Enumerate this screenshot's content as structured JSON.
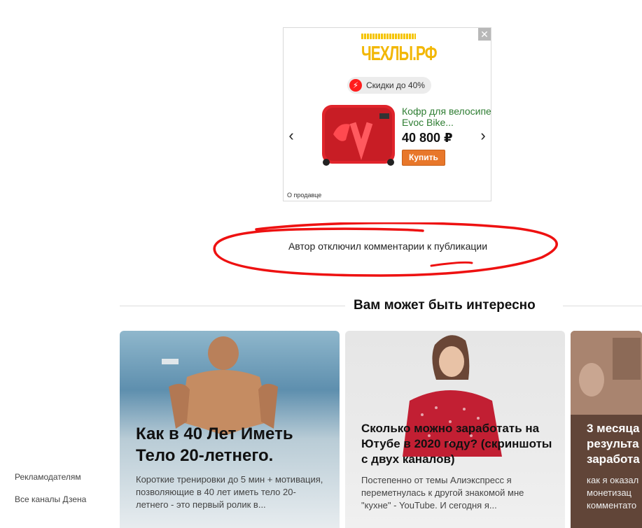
{
  "ad": {
    "close_glyph": "✕",
    "logo_text": "ЧЕХЛЫ.РФ",
    "discount_label": "Скидки до 40%",
    "product_title": "Кофр для велосипеда Evoc Bike...",
    "product_title_line1": "Кофр для велосипе,",
    "product_title_line2": "Evoc Bike...",
    "price": "40 800 ₽",
    "buy_label": "Купить",
    "seller_link": "О продавце",
    "prev_arrow": "‹",
    "next_arrow": "›",
    "icon_names": [
      "lightning-icon",
      "chevron-left-icon",
      "chevron-right-icon",
      "close-icon"
    ]
  },
  "comments": {
    "disabled_text": "Автор отключил комментарии к публикации",
    "annotation_color": "#e11"
  },
  "recommendations": {
    "title": "Вам может быть интересно",
    "cards": [
      {
        "title": "Как в 40 Лет Иметь Тело 20-летнего.",
        "snippet": "Короткие тренировки до 5 мин + мотивация, позволяющие в 40 лет иметь тело 20-летнего - это первый ролик в..."
      },
      {
        "title": "Сколько можно заработать на Ютубе в 2020 году? (скриншоты с двух каналов)",
        "snippet": "Постепенно от темы Алиэкспресс я переметнулась к другой знакомой мне \"кухне\" - YouTube. И сегодня я..."
      },
      {
        "title_line1": "3 месяца",
        "title_line2": "результа",
        "title_line3": "заработа",
        "snippet_line1": "как я оказал",
        "snippet_line2": "монетизац",
        "snippet_line3": "комментато"
      }
    ]
  },
  "footer": {
    "advertisers": "Рекламодателям",
    "all_channels": "Все каналы Дзена"
  }
}
